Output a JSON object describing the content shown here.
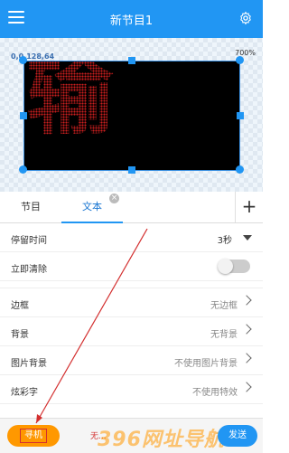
{
  "header": {
    "title": "新节目1",
    "menu_icon": "menu-icon",
    "settings_icon": "gear-icon"
  },
  "canvas": {
    "coord_text": "0,0,128,64",
    "zoom_text": "700%",
    "display_text": "输",
    "display_color": "#c81e1e"
  },
  "tabs": {
    "program_label": "节目",
    "text_label": "文本",
    "add_label": "+"
  },
  "settings": {
    "dwell_time": {
      "label": "停留时间",
      "value": "3秒"
    },
    "clear_now": {
      "label": "立即清除",
      "enabled": false
    },
    "border": {
      "label": "边框",
      "value": "无边框"
    },
    "background": {
      "label": "背景",
      "value": "无背景"
    },
    "image_background": {
      "label": "图片背景",
      "value": "不使用图片背景"
    },
    "colorful_text": {
      "label": "炫彩字",
      "value": "不使用特效"
    }
  },
  "bottom": {
    "find_label": "寻机",
    "status_text": "无...",
    "watermark": "396网址导航",
    "send_label": "发送"
  },
  "colors": {
    "accent": "#2196f3",
    "find_button": "#ff9800",
    "annotation": "#d32f2f"
  }
}
